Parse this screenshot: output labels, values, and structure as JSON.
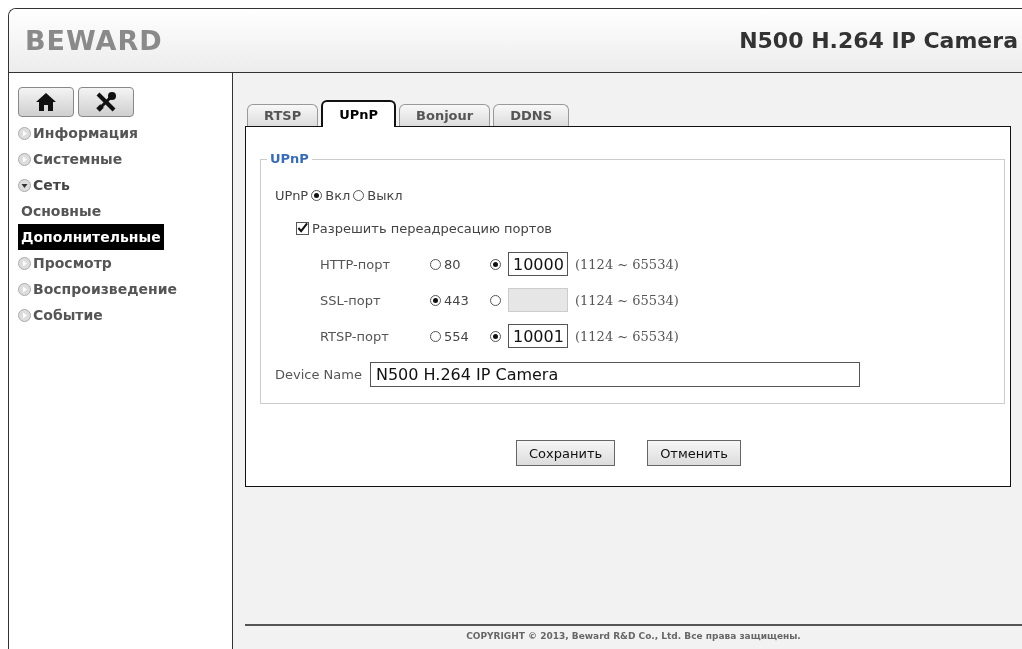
{
  "header": {
    "logo": "BEWARD",
    "title": "N500 H.264 IP Camera"
  },
  "sidebar": {
    "items": [
      {
        "label": "Информация",
        "expanded": false
      },
      {
        "label": "Системные",
        "expanded": false
      },
      {
        "label": "Сеть",
        "expanded": true,
        "children": [
          {
            "label": "Основные",
            "selected": false
          },
          {
            "label": "Дополнительные",
            "selected": true
          }
        ]
      },
      {
        "label": "Просмотр",
        "expanded": false
      },
      {
        "label": "Воспроизведение",
        "expanded": false
      },
      {
        "label": "Событие",
        "expanded": false
      }
    ]
  },
  "tabs": [
    {
      "label": "RTSP",
      "selected": false
    },
    {
      "label": "UPnP",
      "selected": true
    },
    {
      "label": "Bonjour",
      "selected": false
    },
    {
      "label": "DDNS",
      "selected": false
    }
  ],
  "form": {
    "legend": "UPnP",
    "upnp": {
      "label": "UPnP",
      "options": [
        {
          "label": "Вкл",
          "selected": true
        },
        {
          "label": "Выкл",
          "selected": false
        }
      ]
    },
    "forwarding": {
      "label": "Разрешить переадресацию портов",
      "checked": true
    },
    "ports": [
      {
        "label": "HTTP-порт",
        "default": "80",
        "default_selected": false,
        "custom_value": "10000",
        "custom_selected": true,
        "range": "(1124 ~ 65534)"
      },
      {
        "label": "SSL-порт",
        "default": "443",
        "default_selected": true,
        "custom_selected": false,
        "range": "(1124 ~ 65534)"
      },
      {
        "label": "RTSP-порт",
        "default": "554",
        "default_selected": false,
        "custom_value": "10001",
        "custom_selected": true,
        "range": "(1124 ~ 65534)"
      }
    ],
    "device_name": {
      "label": "Device Name",
      "value": "N500 H.264 IP Camera"
    },
    "buttons": [
      "Сохранить",
      "Отменить"
    ]
  },
  "footer": "COPYRIGHT © 2013, Beward R&D Co., Ltd. Все права защищены."
}
